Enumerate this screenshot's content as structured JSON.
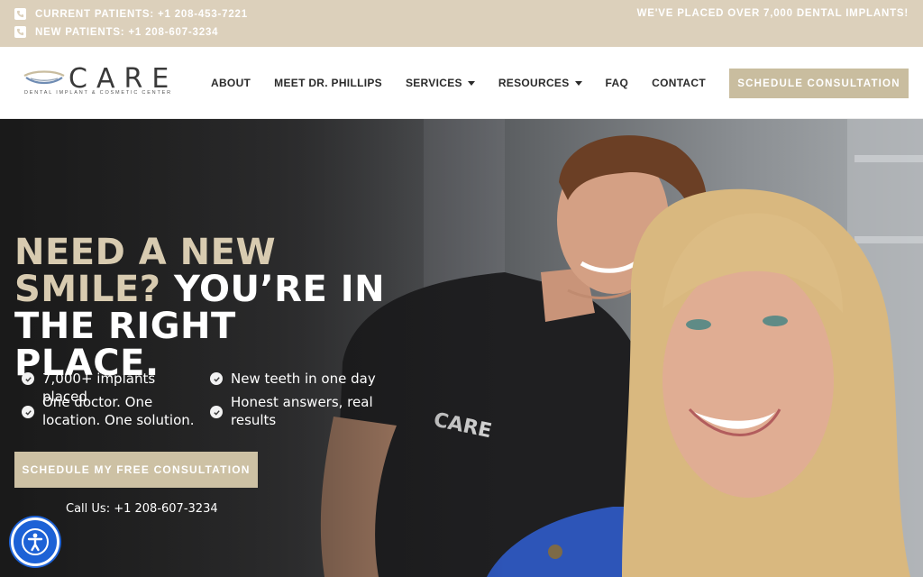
{
  "topbar": {
    "current_patients": "CURRENT PATIENTS: +1 208-453-7221",
    "new_patients": "NEW PATIENTS: +1 208-607-3234",
    "announcement": "WE'VE PLACED OVER 7,000 DENTAL IMPLANTS!"
  },
  "logo": {
    "word": "CARE",
    "tagline": "DENTAL IMPLANT & COSMETIC CENTER"
  },
  "nav": {
    "items": [
      {
        "label": "ABOUT"
      },
      {
        "label": "MEET DR. PHILLIPS"
      },
      {
        "label": "SERVICES"
      },
      {
        "label": "RESOURCES"
      },
      {
        "label": "FAQ"
      },
      {
        "label": "CONTACT"
      }
    ],
    "cta": "SCHEDULE CONSULTATION"
  },
  "hero": {
    "headline_gold": "NEED A NEW SMILE?",
    "headline_white": "YOU’RE IN THE RIGHT PLACE.",
    "features": [
      "7,000+ implants placed",
      "New teeth in one day",
      "One doctor. One location. One solution.",
      "Honest answers, real results"
    ],
    "cta": "SCHEDULE MY FREE CONSULTATION",
    "call_label": "Call Us:",
    "call_number": "+1 208-607-3234"
  },
  "colors": {
    "topbar_bg": "#dcd0bb",
    "accent_gold": "#c9bd9f",
    "headline_gold": "#d8cbb0",
    "accessibility_blue": "#1d62d6"
  },
  "icons": [
    "phone-icon",
    "checkmark-icon",
    "caret-down-icon",
    "accessibility-icon"
  ]
}
